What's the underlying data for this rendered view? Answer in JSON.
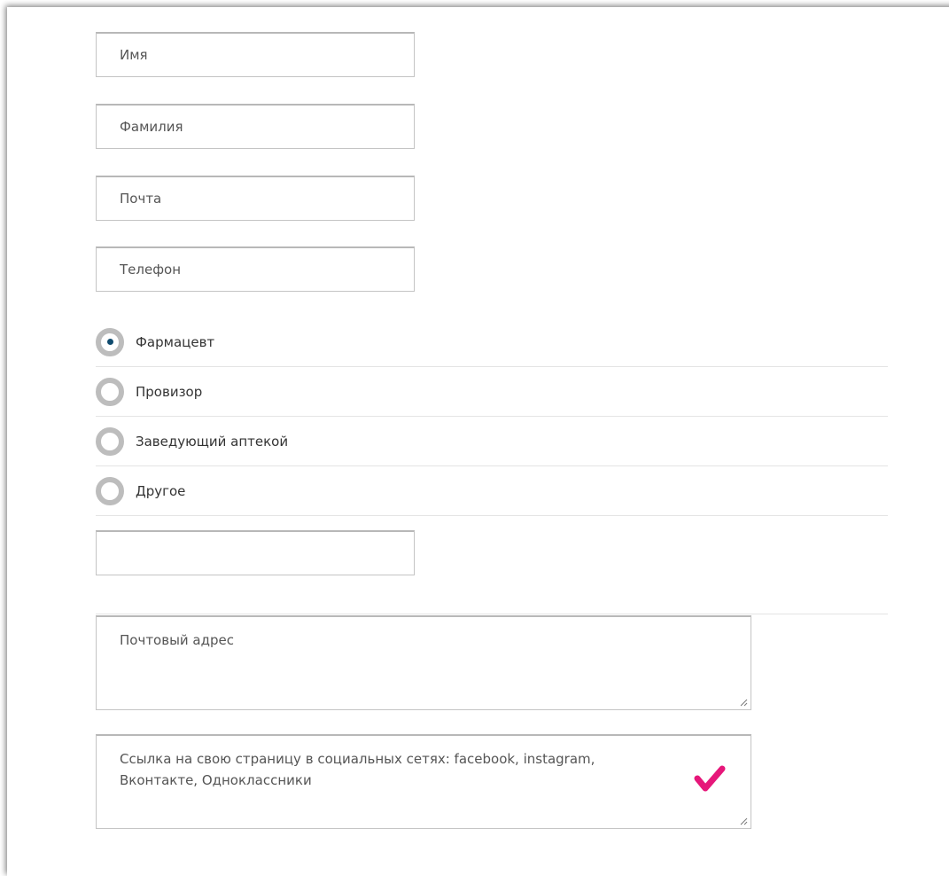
{
  "form": {
    "first_name": {
      "placeholder": "Имя",
      "value": ""
    },
    "last_name": {
      "placeholder": "Фамилия",
      "value": ""
    },
    "email": {
      "placeholder": "Почта",
      "value": ""
    },
    "phone": {
      "placeholder": "Телефон",
      "value": ""
    },
    "position_options": [
      {
        "label": "Фармацевт",
        "checked": true
      },
      {
        "label": "Провизор",
        "checked": false
      },
      {
        "label": "Заведующий аптекой",
        "checked": false
      },
      {
        "label": "Другое",
        "checked": false
      }
    ],
    "other_position": {
      "placeholder": "",
      "value": ""
    },
    "postal_address": {
      "placeholder": "Почтовый адрес"
    },
    "social_link": {
      "placeholder": "Ссылка на свою страницу в социальных сетях: facebook, instagram, Вконтакте, Одноклассники"
    }
  },
  "colors": {
    "radio_border": "#bdbdbd",
    "radio_dot": "#0f4b6e",
    "check_mark": "#e6177a",
    "input_border": "#c4c4c4"
  },
  "icons": {
    "check": "check-mark-icon",
    "resize": "resize-handle-icon"
  }
}
